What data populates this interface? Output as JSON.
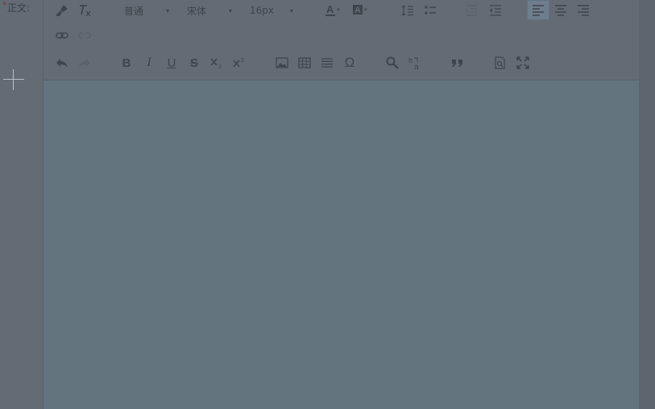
{
  "field": {
    "required_mark": "*",
    "label": "正文:"
  },
  "toolbar": {
    "paragraph_format": "普通",
    "font_family": "宋体",
    "font_size": "16px",
    "icons": {
      "format_painter": "brush-icon",
      "clear_format": "clear-format-icon",
      "font_color": "font-color-icon",
      "background_color": "bg-color-icon",
      "line_height": "line-height-icon",
      "list": "list-icon",
      "indent": "indent-icon",
      "outdent": "outdent-icon",
      "align_left": "align-left-icon",
      "align_center": "align-center-icon",
      "align_right": "align-right-icon",
      "link": "link-icon",
      "unlink": "unlink-icon",
      "undo": "undo-icon",
      "redo": "redo-icon",
      "image": "image-icon",
      "table": "table-icon",
      "hr": "horizontal-rule-icon",
      "special_char": "omega-icon",
      "search": "search-icon",
      "replace": "replace-icon",
      "quote": "quote-icon",
      "preview": "preview-icon",
      "fullscreen": "fullscreen-icon"
    },
    "glyphs": {
      "bold": "B",
      "italic": "I",
      "underline": "U",
      "strike": "S",
      "omega": "Ω"
    }
  }
}
